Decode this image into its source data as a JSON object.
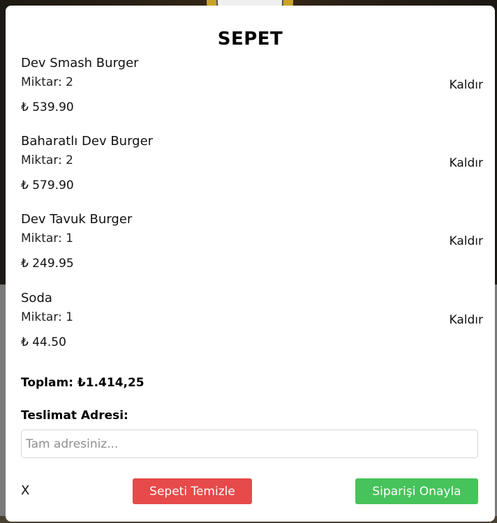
{
  "modal": {
    "title": "SEPET",
    "items": [
      {
        "name": "Dev Smash Burger",
        "quantity": "Miktar: 2",
        "price": "₺ 539.90",
        "remove_label": "Kaldır"
      },
      {
        "name": "Baharatlı Dev Burger",
        "quantity": "Miktar: 2",
        "price": "₺ 579.90",
        "remove_label": "Kaldır"
      },
      {
        "name": "Dev Tavuk Burger",
        "quantity": "Miktar: 1",
        "price": "₺ 249.95",
        "remove_label": "Kaldır"
      },
      {
        "name": "Soda",
        "quantity": "Miktar: 1",
        "price": "₺ 44.50",
        "remove_label": "Kaldır"
      }
    ],
    "total": "Toplam: ₺1.414,25",
    "address_label": "Teslimat Adresi:",
    "address_placeholder": "Tam adresiniz...",
    "close_label": "X",
    "clear_label": "Sepeti Temizle",
    "confirm_label": "Siparişi Onayla"
  },
  "colors": {
    "clear_button": "#e64a4a",
    "confirm_button": "#46c35a"
  }
}
